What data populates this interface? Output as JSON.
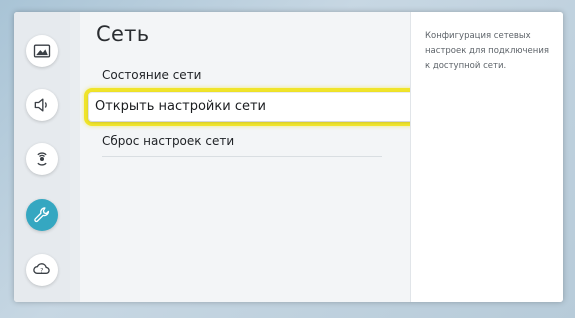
{
  "page": {
    "title": "Сеть"
  },
  "menu": {
    "items": [
      {
        "label": "Состояние сети"
      },
      {
        "label": "Открыть настройки сети",
        "selected": true
      },
      {
        "label": "Сброс настроек сети"
      }
    ]
  },
  "sidebar": {
    "items": [
      {
        "icon": "picture-icon"
      },
      {
        "icon": "sound-icon"
      },
      {
        "icon": "broadcast-icon"
      },
      {
        "icon": "wrench-icon",
        "active": true
      },
      {
        "icon": "support-icon"
      }
    ]
  },
  "description": {
    "text": "Конфигурация сетевых настроек для подключения к доступной сети."
  },
  "colors": {
    "focus_ring": "#f0e42a",
    "active_icon_bg": "#35a7c1",
    "panel_bg": "#ffffff"
  }
}
